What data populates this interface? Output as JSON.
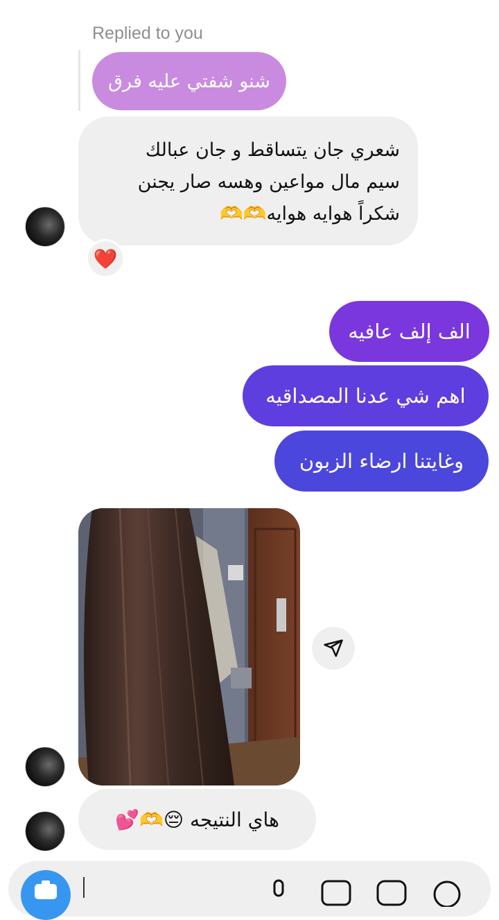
{
  "reply": {
    "label": "Replied to you",
    "quoted_text": "شنو شفتي عليه فرق"
  },
  "messages": {
    "incoming_1": {
      "lines": [
        "شعري جان يتساقط و جان عبالك",
        "سيم مال مواعين وهسه صار يجنن",
        "شكراً هوايه هوايه🫶🫶"
      ],
      "reaction": "❤️"
    },
    "outgoing": [
      {
        "text": "الف إلف عافيه"
      },
      {
        "text": "اهم شي عدنا المصداقيه"
      },
      {
        "text": "وغايتنا ارضاء الزبون"
      }
    ],
    "incoming_last": {
      "text": "هاي النتيجه 😔🫶💕"
    }
  },
  "colors": {
    "reply_bubble": "#c98be0",
    "incoming_bubble": "#efefef",
    "outgoing_1": "#7a37de",
    "outgoing_2": "#5f3ee0",
    "outgoing_3": "#4b46dc",
    "camera_button": "#3797f0"
  },
  "icons": {
    "share": "paper-plane-icon",
    "camera": "camera-icon",
    "mic": "microphone-icon",
    "gallery": "image-icon",
    "sticker": "sticker-icon",
    "add": "plus-circle-icon"
  }
}
